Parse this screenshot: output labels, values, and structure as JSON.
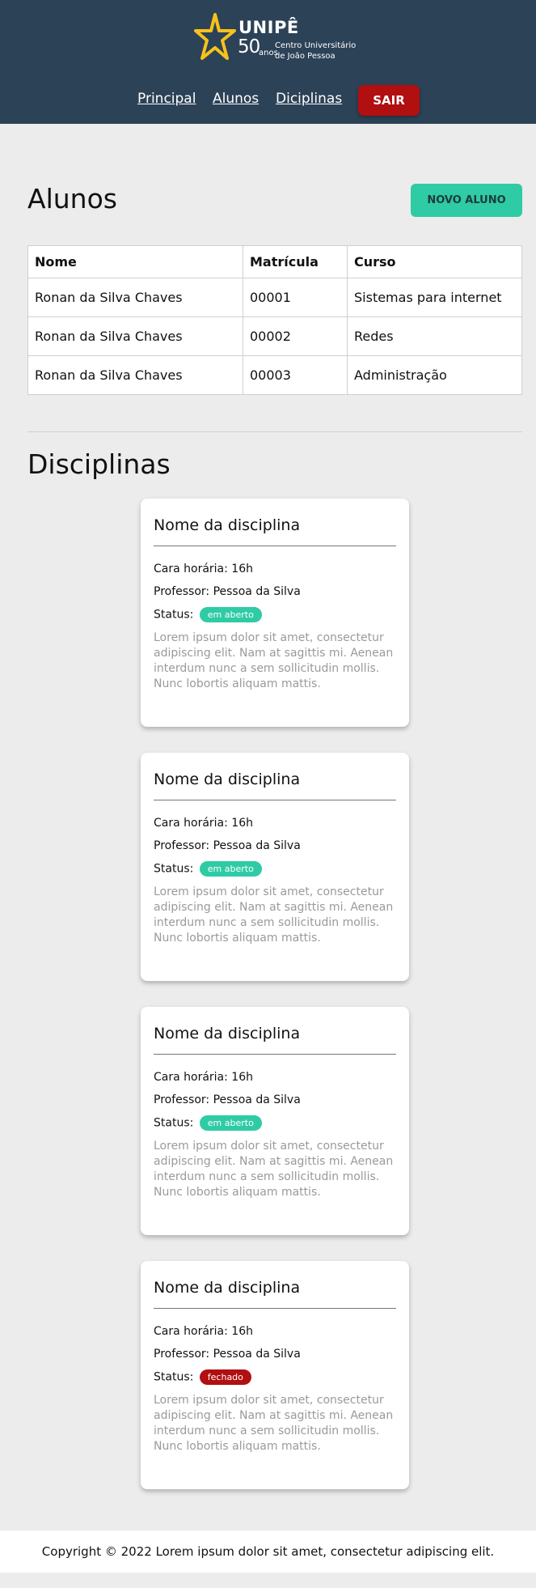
{
  "brand": {
    "name": "UNIPÊ",
    "fifty": "50",
    "anos": "anos",
    "sub_line1": "Centro Universitário",
    "sub_line2": "de João Pessoa",
    "star_color": "#f7c21b"
  },
  "nav": {
    "principal": "Principal",
    "alunos": "Alunos",
    "disciplinas": "Diciplinas",
    "sair": "SAIR"
  },
  "alunos": {
    "title": "Alunos",
    "new_button": "NOVO ALUNO",
    "columns": [
      "Nome",
      "Matrícula",
      "Curso"
    ],
    "rows": [
      [
        "Ronan da Silva Chaves",
        "00001",
        "Sistemas para internet"
      ],
      [
        "Ronan da Silva Chaves",
        "00002",
        "Redes"
      ],
      [
        "Ronan da Silva Chaves",
        "00003",
        "Administração"
      ]
    ]
  },
  "disciplinas": {
    "title": "Disciplinas",
    "cards": [
      {
        "title": "Nome da disciplina",
        "carga": "Cara horária: 16h",
        "professor": "Professor: Pessoa da Silva",
        "status_label": "Status:",
        "status": "em aberto",
        "status_color": "#2fcba5",
        "description": "Lorem ipsum dolor sit amet, consectetur adipiscing elit. Nam at sagittis mi. Aenean interdum nunc a sem sollicitudin mollis. Nunc lobortis aliquam mattis."
      },
      {
        "title": "Nome da disciplina",
        "carga": "Cara horária: 16h",
        "professor": "Professor: Pessoa da Silva",
        "status_label": "Status:",
        "status": "em aberto",
        "status_color": "#2fcba5",
        "description": "Lorem ipsum dolor sit amet, consectetur adipiscing elit. Nam at sagittis mi. Aenean interdum nunc a sem sollicitudin mollis. Nunc lobortis aliquam mattis."
      },
      {
        "title": "Nome da disciplina",
        "carga": "Cara horária: 16h",
        "professor": "Professor: Pessoa da Silva",
        "status_label": "Status:",
        "status": "em aberto",
        "status_color": "#2fcba5",
        "description": "Lorem ipsum dolor sit amet, consectetur adipiscing elit. Nam at sagittis mi. Aenean interdum nunc a sem sollicitudin mollis. Nunc lobortis aliquam mattis."
      },
      {
        "title": "Nome da disciplina",
        "carga": "Cara horária: 16h",
        "professor": "Professor: Pessoa da Silva",
        "status_label": "Status:",
        "status": "fechado",
        "status_color": "#b10f10",
        "description": "Lorem ipsum dolor sit amet, consectetur adipiscing elit. Nam at sagittis mi. Aenean interdum nunc a sem sollicitudin mollis. Nunc lobortis aliquam mattis."
      }
    ]
  },
  "footer": {
    "text": "Copyright © 2022 Lorem ipsum dolor sit amet, consectetur adipiscing elit."
  },
  "colors": {
    "header_bg": "#2c4257",
    "accent": "#2fcba5",
    "danger": "#b10f10"
  }
}
